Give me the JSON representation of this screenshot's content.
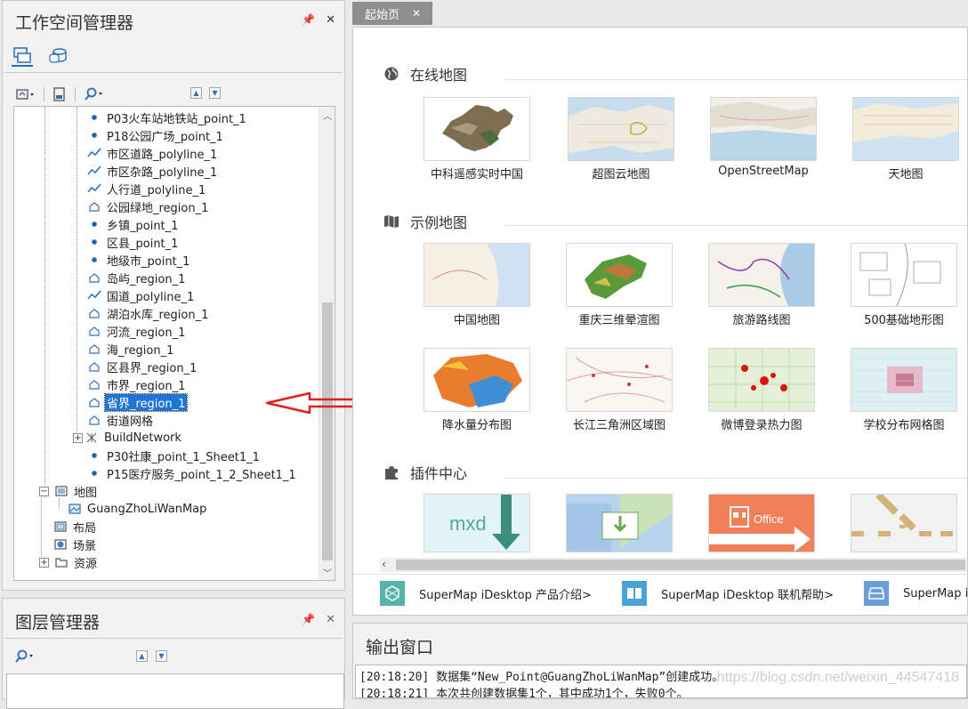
{
  "workspace": {
    "title": "工作空间管理器",
    "tabs": [
      "workspace-tree-icon",
      "database-icon"
    ],
    "tree_items": [
      {
        "label": "P03火车站地铁站_point_1",
        "icon": "point-icon"
      },
      {
        "label": "P18公园广场_point_1",
        "icon": "point-icon"
      },
      {
        "label": "市区道路_polyline_1",
        "icon": "line-icon"
      },
      {
        "label": "市区杂路_polyline_1",
        "icon": "line-icon"
      },
      {
        "label": "人行道_polyline_1",
        "icon": "line-icon"
      },
      {
        "label": "公园绿地_region_1",
        "icon": "region-icon"
      },
      {
        "label": "乡镇_point_1",
        "icon": "point-icon"
      },
      {
        "label": "区县_point_1",
        "icon": "point-icon"
      },
      {
        "label": "地级市_point_1",
        "icon": "point-icon"
      },
      {
        "label": "岛屿_region_1",
        "icon": "region-icon"
      },
      {
        "label": "国道_polyline_1",
        "icon": "line-icon"
      },
      {
        "label": "湖泊水库_region_1",
        "icon": "region-icon"
      },
      {
        "label": "河流_region_1",
        "icon": "region-icon"
      },
      {
        "label": "海_region_1",
        "icon": "region-icon"
      },
      {
        "label": "区县界_region_1",
        "icon": "region-icon"
      },
      {
        "label": "市界_region_1",
        "icon": "region-icon"
      },
      {
        "label": "省界_region_1",
        "icon": "region-icon",
        "selected": true
      },
      {
        "label": "街道网格",
        "icon": "region-icon"
      },
      {
        "label": "BuildNetwork",
        "icon": "network-icon",
        "collapsed": true
      },
      {
        "label": "P30社康_point_1_Sheet1_1",
        "icon": "point-icon"
      },
      {
        "label": "P15医疗服务_point_1_2_Sheet1_1",
        "icon": "point-icon"
      }
    ],
    "maps_label": "地图",
    "map_child": "GuangZhoLiWanMap",
    "layout_label": "布局",
    "scene_label": "场景",
    "resources_label": "资源"
  },
  "layer_manager": {
    "title": "图层管理器"
  },
  "start_page": {
    "tab_label": "起始页",
    "online_maps": {
      "title": "在线地图",
      "items": [
        "中科遥感实时中国",
        "超图云地图",
        "OpenStreetMap",
        "天地图"
      ]
    },
    "sample_maps": {
      "title": "示例地图",
      "items": [
        "中国地图",
        "重庆三维晕渲图",
        "旅游路线图",
        "500基础地形图",
        "降水量分布图",
        "长江三角洲区域图",
        "微博登录热力图",
        "学校分布网格图"
      ]
    },
    "plugin_center": {
      "title": "插件中心",
      "items": [
        "mxd",
        "download",
        "Office",
        "arrow"
      ]
    },
    "footer_links": [
      "SuperMap iDesktop 产品介绍>",
      "SuperMap iDesktop 联机帮助>",
      "SuperMap i"
    ]
  },
  "output": {
    "title": "输出窗口",
    "lines": [
      "[20:18:20] 数据集“New_Point@GuangZhoLiWanMap”创建成功。",
      "[20:18:21] 本次共创建数据集1个，其中成功1个，失败0个。"
    ],
    "watermark": "https://blog.csdn.net/weixin_44547418"
  },
  "colors": {
    "selection": "#1f75d1",
    "accent": "#1a6fc8",
    "arrow": "#e02020"
  }
}
